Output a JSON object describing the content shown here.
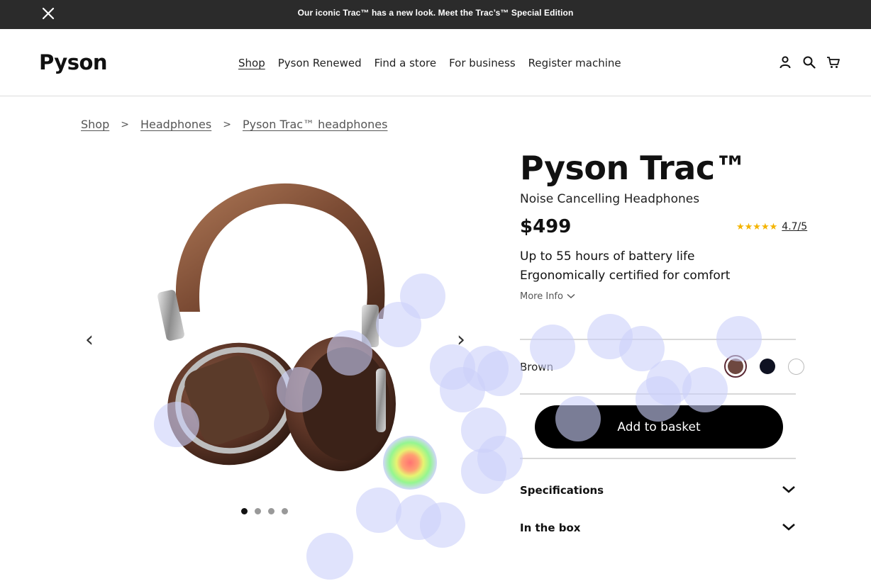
{
  "announcement": {
    "message": "Our iconic Trac™ has a new look. Meet the Trac’s™ Special Edition",
    "close_icon": "close-icon"
  },
  "header": {
    "logo": "Pyson",
    "nav": [
      "Shop",
      "Pyson Renewed",
      "Find a store",
      "For business",
      "Register machine"
    ],
    "active_nav": "Shop",
    "icons": [
      "account-icon",
      "search-icon",
      "cart-icon"
    ]
  },
  "breadcrumb": {
    "items": [
      "Shop",
      "Headphones",
      "Pyson Trac™ headphones"
    ],
    "separator": ">"
  },
  "gallery": {
    "prev_icon": "chevron-left-icon",
    "next_icon": "chevron-right-icon",
    "slide_count": 4,
    "active_slide": 1,
    "prev_glyph": "‹",
    "next_glyph": "›"
  },
  "product": {
    "title": "Pyson Trac™",
    "subtitle": "Noise Cancelling Headphones",
    "price": "$499",
    "stars": "★★★★★",
    "rating": "4.7/5",
    "features": [
      "Up to 55 hours of battery life",
      "Ergonomically certified for comfort"
    ],
    "more_info": "More Info",
    "color_label": "Brown",
    "colors": [
      {
        "name": "brown",
        "hex": "#6e4840",
        "selected": true
      },
      {
        "name": "black",
        "hex": "#0f1222",
        "selected": false
      },
      {
        "name": "white",
        "hex": "#ffffff",
        "selected": false
      }
    ],
    "add_to_basket": "Add to basket",
    "accordions": [
      "Specifications",
      "In the box"
    ]
  },
  "colors": {
    "announcement_bg": "#2b2b2b",
    "button_bg": "#000000",
    "star": "#f4b400",
    "heat_blob": "#d9dcfb"
  }
}
